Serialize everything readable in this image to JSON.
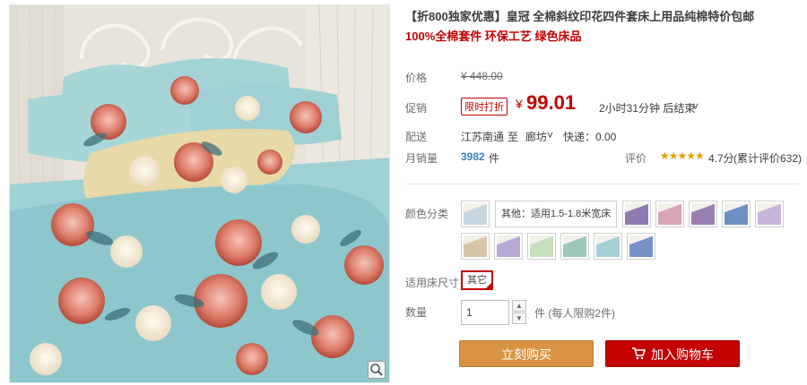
{
  "product": {
    "title": "【折800独家优惠】皇冠 全棉斜纹印花四件套床上用品纯棉特价包邮",
    "subtitle": "100%全棉套件 环保工艺 绿色床品"
  },
  "price_row": {
    "label": "价格",
    "original": "¥ 448.00"
  },
  "promo_row": {
    "label": "促销",
    "badge": "限时打折",
    "currency": "¥",
    "price": "99.01",
    "countdown": "2小时31分钟 后结束",
    "dropdown_arrow": "˅"
  },
  "shipping_row": {
    "label": "配送",
    "from": "江苏南通",
    "to_word": "至",
    "to": "廊坊",
    "to_arrow": "˅",
    "fee": "快递：0.00"
  },
  "sales_row": {
    "label": "月销量",
    "count": "3982",
    "unit": "件",
    "rating_label": "评价",
    "stars": "★★★★★",
    "rating": "4.7分",
    "review_count": "(累计评价632)"
  },
  "color_row": {
    "label": "颜色分类",
    "selected_text": "其他：适用1.5-1.8米宽床",
    "swatch_colors": [
      "#c9d8e0",
      "#8f7bb0",
      "#d6a6b8",
      "#9a7fb1",
      "#6d8fc4",
      "#c8b4d8",
      "#d6c6a8",
      "#b8a8d8",
      "#c6e0c0",
      "#9cc8b8",
      "#a6d0d8",
      "#7890c8",
      "#8ab4d6"
    ]
  },
  "size_row": {
    "label": "适用床尺寸",
    "option": "其它"
  },
  "quantity_row": {
    "label": "数量",
    "value": "1",
    "unit_note": "件 (每人限购2件)",
    "up": "▲",
    "down": "▼"
  },
  "buttons": {
    "buy_now": "立刻购买",
    "add_to_cart": "加入购物车"
  },
  "colors": {
    "accent_red": "#c40000",
    "buy_orange": "#d99443"
  }
}
